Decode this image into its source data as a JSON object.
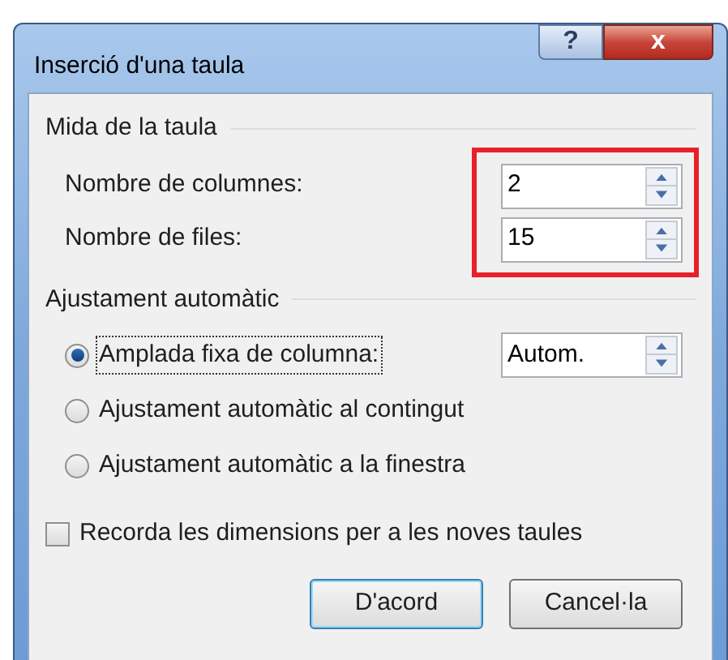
{
  "window": {
    "title": "Inserció d'una taula",
    "help_button": "?",
    "close_button": "x"
  },
  "table_size": {
    "title": "Mida de la taula",
    "highlighted": true,
    "fields": [
      {
        "label": "Nombre de columnes:",
        "value": "2"
      },
      {
        "label": "Nombre de files:",
        "value": "15"
      }
    ]
  },
  "autofit": {
    "title": "Ajustament automàtic",
    "options": [
      {
        "label": "Amplada fixa de columna:",
        "selected": true,
        "focused": true,
        "value": "Autom."
      },
      {
        "label": "Ajustament automàtic al contingut",
        "selected": false,
        "focused": false
      },
      {
        "label": "Ajustament automàtic a la finestra",
        "selected": false,
        "focused": false
      }
    ]
  },
  "remember": {
    "label": "Recorda les dimensions per a les noves taules",
    "checked": false
  },
  "buttons": [
    {
      "label": "D'acord",
      "default": true
    },
    {
      "label": "Cancel·la",
      "default": false
    }
  ]
}
